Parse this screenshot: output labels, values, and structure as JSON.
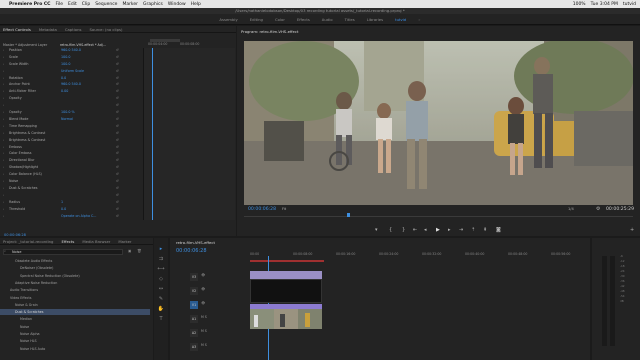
{
  "menubar": {
    "apple": "",
    "items": [
      "Premiere Pro CC",
      "File",
      "Edit",
      "Clip",
      "Sequence",
      "Marker",
      "Graphics",
      "Window",
      "Help"
    ],
    "right": [
      "100%",
      "Tue 3:04 PM",
      "tutvid"
    ]
  },
  "titlebar": "/Users/nathanielodobson/Desktop/03 recording tutorial assets/_tutorial-recording.prproj *",
  "workspaces": [
    "Assembly",
    "Editing",
    "Color",
    "Effects",
    "Audio",
    "Titles",
    "Libraries",
    "tutvid"
  ],
  "workspace_active": "tutvid",
  "effect_controls": {
    "tabs": [
      "Effect Controls",
      "Metadata",
      "Captions",
      "Source: (no clips)"
    ],
    "master": "Master * Adjustment Layer",
    "clip": "retro-film-VHS-effect * Adj...",
    "ruler": [
      "00:00:04:00",
      "00:00:08:00"
    ],
    "rows": [
      {
        "label": "Position",
        "value": "960.0    540.0"
      },
      {
        "label": "Scale",
        "value": "100.0"
      },
      {
        "label": "Scale Width",
        "value": "100.0"
      },
      {
        "label": "",
        "value": "Uniform Scale"
      },
      {
        "label": "Rotation",
        "value": "0.0"
      },
      {
        "label": "Anchor Point",
        "value": "960.0    540.0"
      },
      {
        "label": "Anti-flicker Filter",
        "value": "0.00"
      },
      {
        "label": "Opacity",
        "value": ""
      },
      {
        "label": "",
        "value": ""
      },
      {
        "label": "Opacity",
        "value": "100.0 %"
      },
      {
        "label": "Blend Mode",
        "value": "Normal"
      },
      {
        "label": "Time Remapping",
        "value": ""
      },
      {
        "label": "Brightness & Contrast",
        "value": ""
      },
      {
        "label": "Brightness & Contrast",
        "value": ""
      },
      {
        "label": "Emboss",
        "value": ""
      },
      {
        "label": "Color Emboss",
        "value": ""
      },
      {
        "label": "Directional Blur",
        "value": ""
      },
      {
        "label": "Shadow/Highlight",
        "value": ""
      },
      {
        "label": "Color Balance (HLS)",
        "value": ""
      },
      {
        "label": "Noise",
        "value": ""
      },
      {
        "label": "Dust & Scratches",
        "value": ""
      },
      {
        "label": "",
        "value": ""
      },
      {
        "label": "Radius",
        "value": "1"
      },
      {
        "label": "Threshold",
        "value": "0.0"
      },
      {
        "label": "",
        "value": "Operate on Alpha C..."
      }
    ],
    "timecode": "00:00:06:28"
  },
  "program": {
    "title": "Program: retro-film-VHS-effect",
    "timecode_left": "00:00:06:28",
    "fit": "Fit",
    "quality": "1/4",
    "timecode_right": "00:00:25:29"
  },
  "project": {
    "tabs": [
      "Project: _tutorial-recording",
      "Effects",
      "Media Browser",
      "Marker"
    ],
    "search": "Noise",
    "items": [
      {
        "label": "Obsolete Audio Effects",
        "indent": 1
      },
      {
        "label": "DeNoiser (Obsolete)",
        "indent": 2
      },
      {
        "label": "Spectral Noise Reduction (Obsolete)",
        "indent": 2
      },
      {
        "label": "Adaptive Noise Reduction",
        "indent": 1
      },
      {
        "label": "Audio Transitions",
        "indent": 0
      },
      {
        "label": "Video Effects",
        "indent": 0
      },
      {
        "label": "Noise & Grain",
        "indent": 1
      },
      {
        "label": "Dust & Scratches",
        "indent": 2,
        "selected": true
      },
      {
        "label": "Median",
        "indent": 2
      },
      {
        "label": "Noise",
        "indent": 2
      },
      {
        "label": "Noise Alpha",
        "indent": 2
      },
      {
        "label": "Noise HLS",
        "indent": 2
      },
      {
        "label": "Noise HLS Auto",
        "indent": 2
      }
    ]
  },
  "timeline": {
    "tab": "retro-film-VHS-effect",
    "timecode": "00:00:06:28",
    "ruler": [
      "00:00",
      "00:00:08:00",
      "00:00:16:00",
      "00:00:24:00",
      "00:00:32:00",
      "00:00:40:00",
      "00:00:48:00",
      "00:00:56:00"
    ],
    "tracks": [
      "V3",
      "V2",
      "V1",
      "A1",
      "A2",
      "A3"
    ],
    "clip_adj": "fx Adjustment Layer",
    "clip_video": "retro-film-VHS-effect"
  },
  "colors": {
    "accent": "#3e8fe0",
    "selection": "#3c4c66",
    "adjustment": "#9a8fc4",
    "video_clip": "#8c7bd0"
  }
}
